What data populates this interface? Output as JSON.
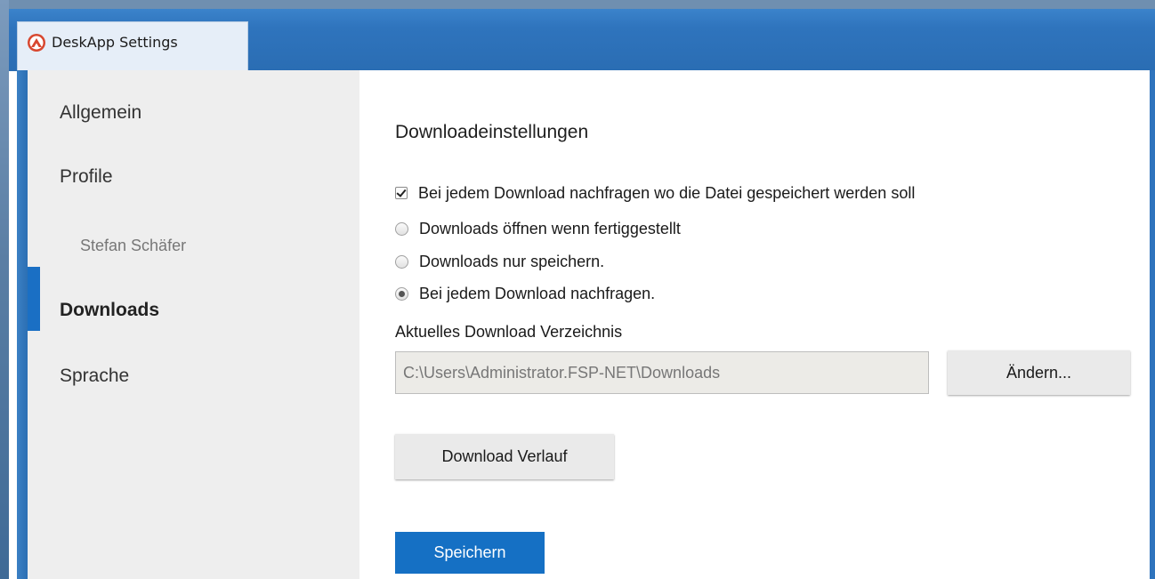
{
  "window": {
    "title": "DeskApp Settings",
    "icon": "app-logo-icon"
  },
  "sidebar": {
    "items": [
      {
        "label": "Allgemein"
      },
      {
        "label": "Profile"
      },
      {
        "label": "Stefan Schäfer"
      },
      {
        "label": "Downloads"
      },
      {
        "label": "Sprache"
      }
    ],
    "active_color": "#1a6fc4"
  },
  "downloads": {
    "section_title": "Downloadeinstellungen",
    "ask_location": {
      "label": "Bei jedem Download nachfragen wo die Datei gespeichert werden soll",
      "checked": true
    },
    "options": [
      {
        "label": "Downloads öffnen wenn fertiggestellt",
        "selected": false
      },
      {
        "label": "Downloads nur speichern.",
        "selected": false
      },
      {
        "label": "Bei jedem Download nachfragen.",
        "selected": true
      }
    ],
    "directory_label": "Aktuelles Download Verzeichnis",
    "directory_value": "C:\\Users\\Administrator.FSP-NET\\Downloads",
    "change_button": "Ändern...",
    "history_button": "Download Verlauf",
    "save_button": "Speichern",
    "save_color": "#1570c4"
  }
}
